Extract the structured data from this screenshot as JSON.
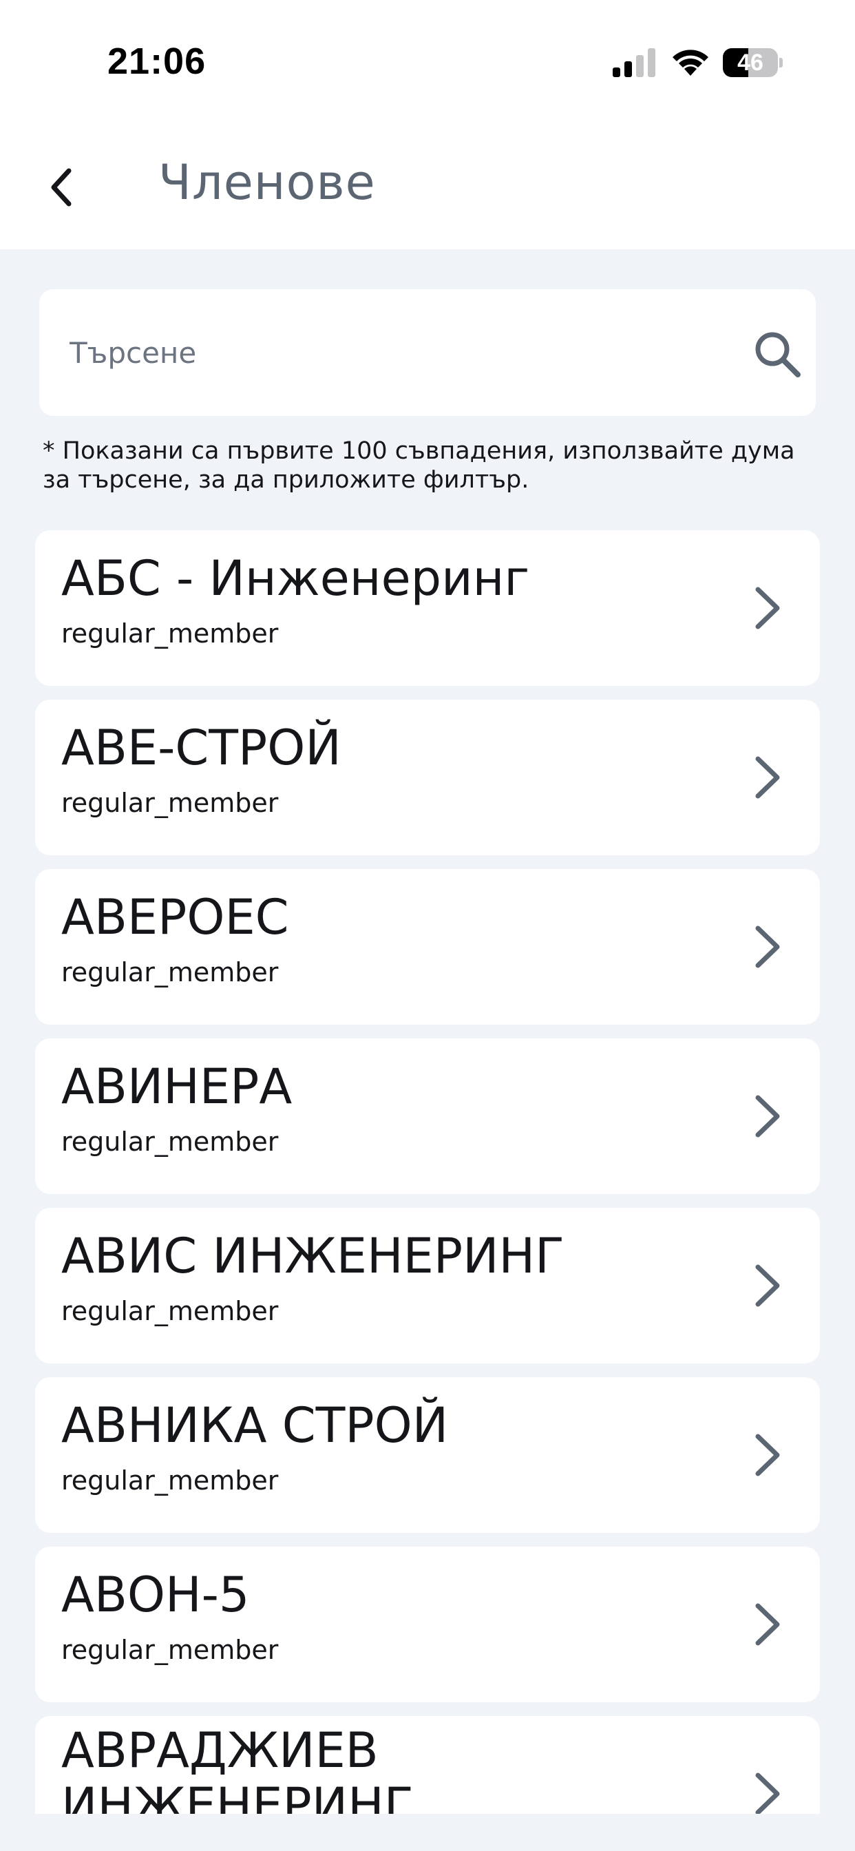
{
  "status_bar": {
    "time": "21:06",
    "battery_level": "46",
    "icons": [
      "signal-icon",
      "wifi-icon",
      "battery-icon"
    ]
  },
  "header": {
    "title": "Членове",
    "back_icon": "chevron-left-icon"
  },
  "search": {
    "placeholder": "Търсене",
    "value": "",
    "icon": "search-icon"
  },
  "hint": "* Показани са първите 100 съвпадения, използвайте дума за търсене, за да приложите филтър.",
  "members": [
    {
      "name": "АБС - Инженеринг",
      "role": "regular_member"
    },
    {
      "name": "АВЕ-СТРОЙ",
      "role": "regular_member"
    },
    {
      "name": "АВЕРОЕС",
      "role": "regular_member"
    },
    {
      "name": "АВИНЕРА",
      "role": "regular_member"
    },
    {
      "name": "АВИС ИНЖЕНЕРИНГ",
      "role": "regular_member"
    },
    {
      "name": "АВНИКА СТРОЙ",
      "role": "regular_member"
    },
    {
      "name": "АВОН-5",
      "role": "regular_member"
    },
    {
      "name": "АВРАДЖИЕВ ИНЖЕНЕРИНГ",
      "role": ""
    }
  ],
  "colors": {
    "background": "#f0f4f9",
    "card": "#ffffff",
    "title_text": "#5c6673",
    "icon": "#5c6673"
  }
}
